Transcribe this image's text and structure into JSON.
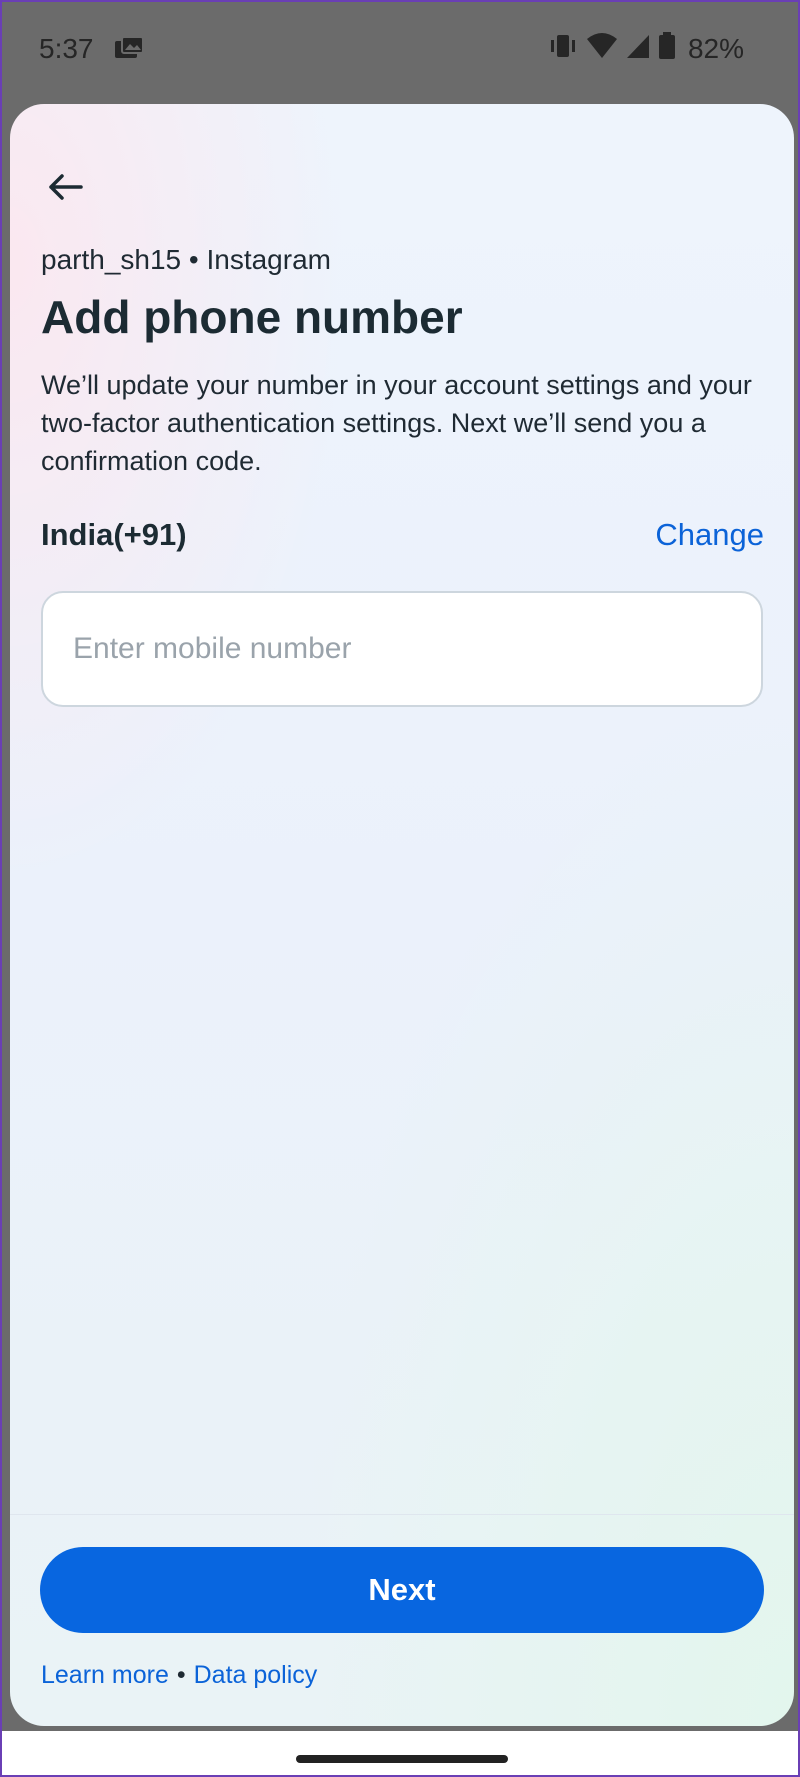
{
  "status_bar": {
    "time": "5:37",
    "battery_percent": "82%",
    "icons": [
      "photo-notification-icon",
      "vibrate-icon",
      "wifi-icon",
      "signal-icon",
      "battery-icon"
    ]
  },
  "header": {
    "back_icon": "arrow-left-icon",
    "account_line": "parth_sh15 • Instagram",
    "title": "Add phone number",
    "description": "We’ll update your number in your account settings and your two-factor authentication settings. Next we’ll send you a confirmation code."
  },
  "form": {
    "country": "India(+91)",
    "change_label": "Change",
    "phone_value": "",
    "phone_placeholder": "Enter mobile number"
  },
  "footer": {
    "next_label": "Next",
    "learn_more": "Learn more",
    "separator": "•",
    "data_policy": "Data policy"
  },
  "colors": {
    "accent": "#0866e0",
    "link": "#0b63d8",
    "title": "#1c2b33"
  }
}
